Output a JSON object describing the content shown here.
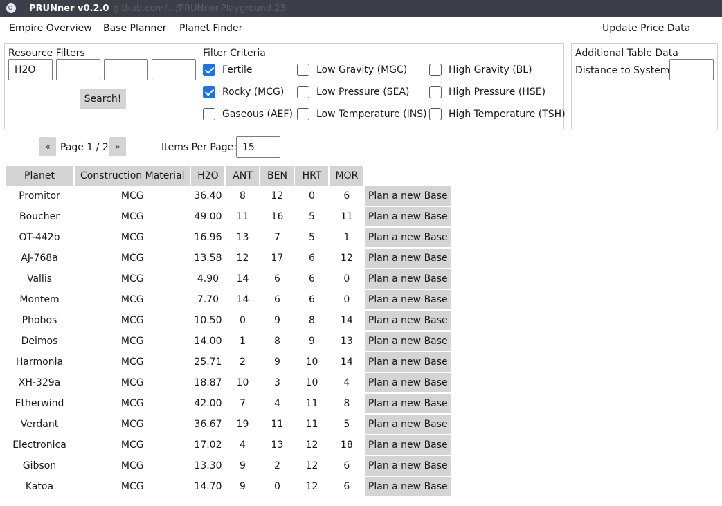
{
  "window": {
    "title": "PRUNner v0.2.0",
    "ghost_text": "github.com/.../PRUNner.Playground.23"
  },
  "menu": {
    "items": [
      "Empire Overview",
      "Base Planner",
      "Planet Finder"
    ],
    "update_price": "Update Price Data"
  },
  "resource_filters": {
    "title": "Resource Filters",
    "values": [
      "H2O",
      "",
      "",
      ""
    ],
    "search_label": "Search!"
  },
  "filter_criteria": {
    "title": "Filter Criteria",
    "options": [
      {
        "label": "Fertile",
        "checked": true
      },
      {
        "label": "Rocky (MCG)",
        "checked": true
      },
      {
        "label": "Gaseous (AEF)",
        "checked": false
      },
      {
        "label": "Low Gravity (MGC)",
        "checked": false
      },
      {
        "label": "Low Pressure (SEA)",
        "checked": false
      },
      {
        "label": "Low Temperature (INS)",
        "checked": false
      },
      {
        "label": "High Gravity (BL)",
        "checked": false
      },
      {
        "label": "High Pressure (HSE)",
        "checked": false
      },
      {
        "label": "High Temperature (TSH)",
        "checked": false
      }
    ]
  },
  "additional": {
    "title": "Additional Table Data",
    "distance_label": "Distance to System:",
    "distance_value": ""
  },
  "pager": {
    "prev": "«",
    "next": "»",
    "page_text": "Page 1 / 2",
    "items_per_page_label": "Items Per Page:",
    "items_per_page": "15"
  },
  "table": {
    "headers": [
      "Planet",
      "Construction Material",
      "H2O",
      "ANT",
      "BEN",
      "HRT",
      "MOR"
    ],
    "action_label": "Plan a new Base",
    "rows": [
      [
        "Promitor",
        "MCG",
        "36.40",
        "8",
        "12",
        "0",
        "6"
      ],
      [
        "Boucher",
        "MCG",
        "49.00",
        "11",
        "16",
        "5",
        "11"
      ],
      [
        "OT-442b",
        "MCG",
        "16.96",
        "13",
        "7",
        "5",
        "1"
      ],
      [
        "AJ-768a",
        "MCG",
        "13.58",
        "12",
        "17",
        "6",
        "12"
      ],
      [
        "Vallis",
        "MCG",
        "4.90",
        "14",
        "6",
        "6",
        "0"
      ],
      [
        "Montem",
        "MCG",
        "7.70",
        "14",
        "6",
        "6",
        "0"
      ],
      [
        "Phobos",
        "MCG",
        "10.50",
        "0",
        "9",
        "8",
        "14"
      ],
      [
        "Deimos",
        "MCG",
        "14.00",
        "1",
        "8",
        "9",
        "13"
      ],
      [
        "Harmonia",
        "MCG",
        "25.71",
        "2",
        "9",
        "10",
        "14"
      ],
      [
        "XH-329a",
        "MCG",
        "18.87",
        "10",
        "3",
        "10",
        "4"
      ],
      [
        "Etherwind",
        "MCG",
        "42.00",
        "7",
        "4",
        "11",
        "8"
      ],
      [
        "Verdant",
        "MCG",
        "36.67",
        "19",
        "11",
        "11",
        "5"
      ],
      [
        "Electronica",
        "MCG",
        "17.02",
        "4",
        "13",
        "12",
        "18"
      ],
      [
        "Gibson",
        "MCG",
        "13.30",
        "9",
        "2",
        "12",
        "6"
      ],
      [
        "Katoa",
        "MCG",
        "14.70",
        "9",
        "0",
        "12",
        "6"
      ]
    ]
  }
}
